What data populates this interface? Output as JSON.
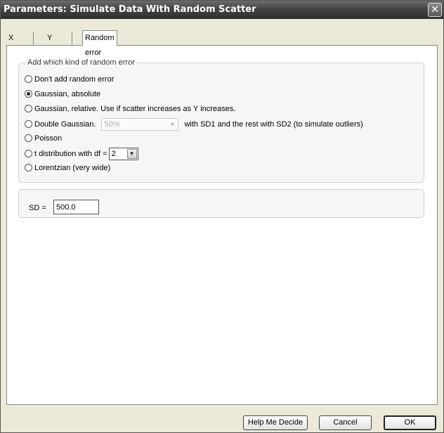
{
  "window": {
    "title": "Parameters: Simulate Data With Random Scatter",
    "close_glyph": "✕"
  },
  "tabs": [
    {
      "label": "X values",
      "active": false
    },
    {
      "label": "Y values",
      "active": false
    },
    {
      "label": "Random error",
      "active": true
    }
  ],
  "error_group": {
    "legend": "Add which kind of random error",
    "options": [
      {
        "label": "Don't add random error",
        "selected": false
      },
      {
        "label": "Gaussian, absolute",
        "selected": true
      },
      {
        "label": "Gaussian, relative. Use if scatter increases as Y increases.",
        "selected": false
      },
      {
        "label": "Double Gaussian.",
        "selected": false,
        "dropdown_value": "50%",
        "suffix": "with SD1 and the rest with SD2 (to simulate outliers)"
      },
      {
        "label": "Poisson",
        "selected": false
      },
      {
        "label": "t distribution with df =",
        "selected": false,
        "dropdown_value": "2"
      },
      {
        "label": "Lorentzian (very wide)",
        "selected": false
      }
    ]
  },
  "sd": {
    "label": "SD =",
    "value": "500.0"
  },
  "buttons": {
    "help": "Help Me Decide",
    "cancel": "Cancel",
    "ok": "OK"
  }
}
